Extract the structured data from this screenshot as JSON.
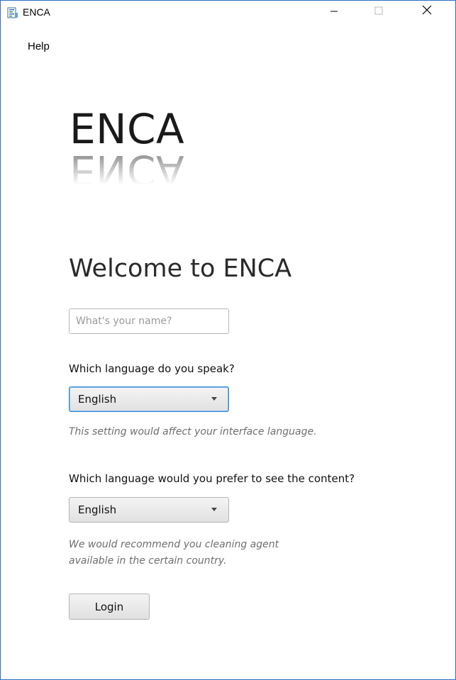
{
  "window": {
    "title": "ENCA"
  },
  "menu": {
    "items": [
      {
        "label": "Help"
      }
    ]
  },
  "logo": {
    "text": "ENCA",
    "reflection_text": "ENCA"
  },
  "welcome": {
    "heading": "Welcome to ENCA"
  },
  "form": {
    "name_placeholder": "What's your name?",
    "name_value": "",
    "interface_language": {
      "label": "Which language do you speak?",
      "selected": "English",
      "hint": "This setting would affect your interface language."
    },
    "content_language": {
      "label": "Which language would you prefer to see the content?",
      "selected": "English",
      "hint_line1": "We would recommend you cleaning agent",
      "hint_line2": "available in the certain country."
    },
    "login_label": "Login"
  },
  "colors": {
    "window_border": "#2b6ec4",
    "focus_ring": "#3a8ad6"
  }
}
